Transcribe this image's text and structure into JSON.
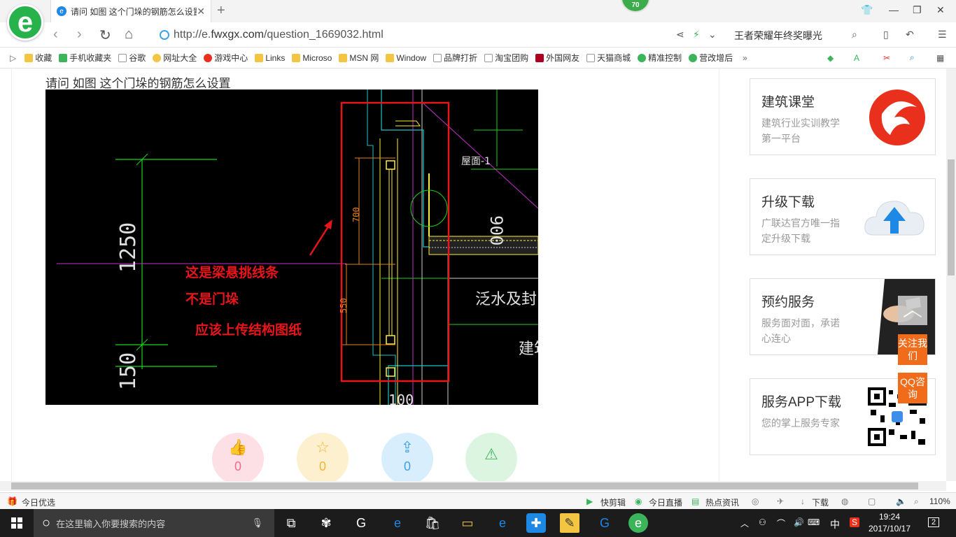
{
  "browser": {
    "tab_title": "请问 如图 这个门垛的钢筋怎么设置",
    "badge_number": "70",
    "url_prefix": "http://e.",
    "url_host": "fwxgx.com",
    "url_path": "/question_1669032.html",
    "search_text": "王者荣耀年终奖曝光",
    "zoom": "110%"
  },
  "bookmarks": [
    {
      "label": "收藏",
      "icon": "star-icon"
    },
    {
      "label": "手机收藏夹",
      "icon": "phone-icon"
    },
    {
      "label": "谷歌",
      "icon": "page-icon"
    },
    {
      "label": "网址大全",
      "icon": "globe-icon"
    },
    {
      "label": "游戏中心",
      "icon": "game-icon"
    },
    {
      "label": "Links",
      "icon": "folder-icon"
    },
    {
      "label": "Microso",
      "icon": "folder-icon"
    },
    {
      "label": "MSN 网",
      "icon": "folder-icon"
    },
    {
      "label": "Window",
      "icon": "folder-icon"
    },
    {
      "label": "品牌打折",
      "icon": "page-icon"
    },
    {
      "label": "淘宝团购",
      "icon": "page-icon"
    },
    {
      "label": "外国网友",
      "icon": "bookmark-icon"
    },
    {
      "label": "天猫商城",
      "icon": "page-icon"
    },
    {
      "label": "精准控制",
      "icon": "wechat-icon"
    },
    {
      "label": "营改增后",
      "icon": "wechat-icon"
    }
  ],
  "question": {
    "title": "请问 如图 这个门垛的钢筋怎么设置"
  },
  "drawing": {
    "dim_left_top": "1250",
    "dim_left_bottom": "150",
    "dim_700": "700",
    "dim_550": "550",
    "dim_900": "900",
    "dim_100": "100",
    "label_roof": "屋面-1",
    "label_fanshui": "泛水及封口",
    "label_jian": "建筑",
    "annotation_lines": [
      "这是梁悬挑线条",
      "不是门垛",
      "应该上传结构图纸"
    ]
  },
  "actions": [
    {
      "name": "like",
      "icon": "thumbs-up-icon",
      "count": "0",
      "color": "#fde0e6",
      "fg": "#f26b8a"
    },
    {
      "name": "favorite",
      "icon": "star-icon",
      "count": "0",
      "color": "#fdf0cf",
      "fg": "#f3b72f"
    },
    {
      "name": "share",
      "icon": "share-icon",
      "count": "0",
      "color": "#d8eefc",
      "fg": "#3ea1e6"
    },
    {
      "name": "report",
      "icon": "warning-icon",
      "count": "",
      "color": "#dcf5e1",
      "fg": "#3cb55a"
    }
  ],
  "sidebar": [
    {
      "title": "建筑课堂",
      "subtitle": "建筑行业实训教学第一平台"
    },
    {
      "title": "升级下载",
      "subtitle": "广联达官方唯一指定升级下载"
    },
    {
      "title": "预约服务",
      "subtitle": "服务面对面，承诺心连心"
    },
    {
      "title": "服务APP下载",
      "subtitle": "您的掌上服务专家"
    }
  ],
  "float_buttons": {
    "follow": "关注我们",
    "qq": "QQ咨询"
  },
  "statusbar": {
    "left": "今日优选",
    "items": [
      "快剪辑",
      "今日直播",
      "热点资讯",
      "下载"
    ]
  },
  "taskbar": {
    "search_placeholder": "在这里输入你要搜索的内容",
    "time": "19:24",
    "date": "2017/10/17",
    "ime": "中",
    "notifications": "2"
  }
}
